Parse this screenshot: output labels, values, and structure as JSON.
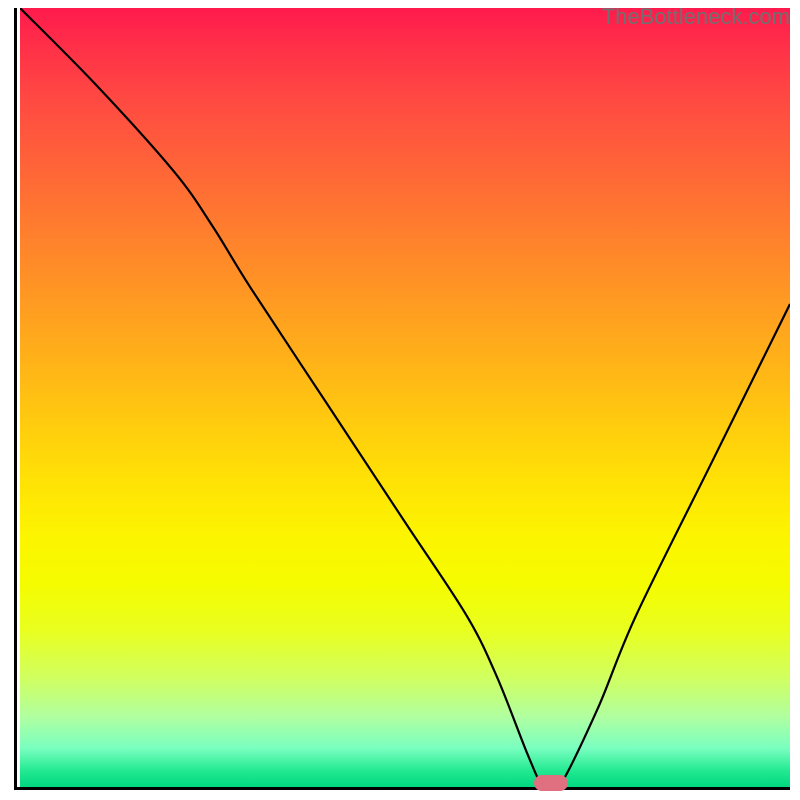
{
  "watermark": "TheBottleneck.com",
  "chart_data": {
    "type": "line",
    "title": "",
    "xlabel": "",
    "ylabel": "",
    "x_range": [
      0,
      100
    ],
    "y_range": [
      0,
      100
    ],
    "x": [
      0,
      10,
      20,
      25,
      30,
      40,
      50,
      58,
      62,
      66,
      68,
      70,
      75,
      80,
      90,
      100
    ],
    "values": [
      100,
      90,
      79,
      72,
      64,
      49,
      34,
      22,
      14,
      4,
      0,
      0,
      10,
      22,
      42,
      62
    ],
    "marker": {
      "x": 69,
      "y": 0
    },
    "gradient": {
      "stops": [
        {
          "pos": 0,
          "color": "#ff1a4d"
        },
        {
          "pos": 50,
          "color": "#ffc710"
        },
        {
          "pos": 75,
          "color": "#f5fc00"
        },
        {
          "pos": 100,
          "color": "#00d880"
        }
      ]
    }
  }
}
